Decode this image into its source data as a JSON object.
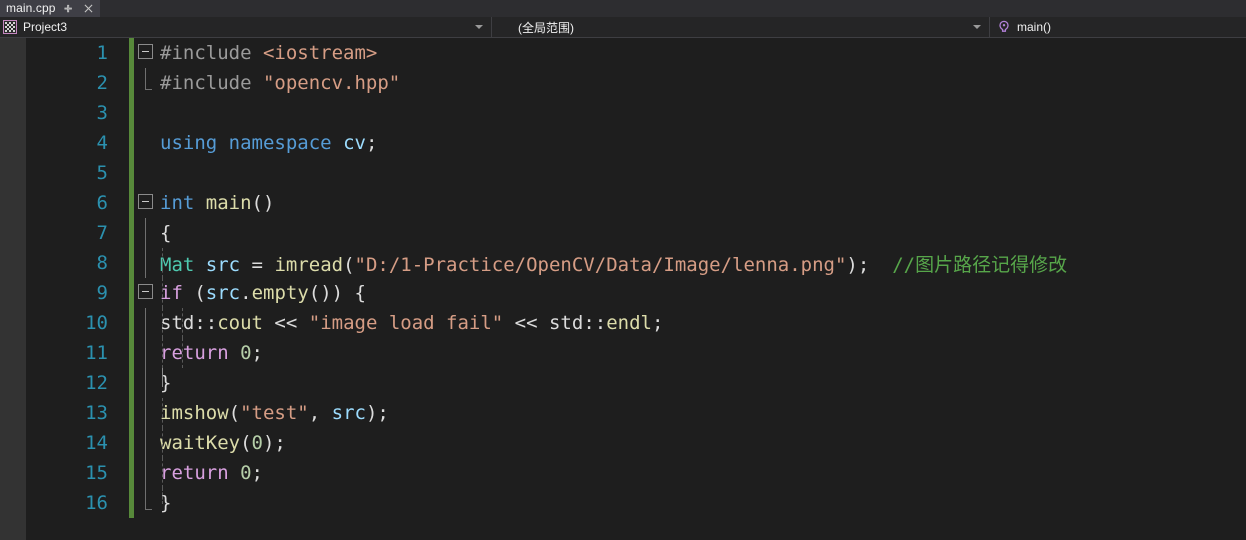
{
  "tab": {
    "label": "main.cpp",
    "pin_icon": "pin-icon",
    "close_icon": "close-icon"
  },
  "navbar": {
    "project": {
      "label": "Project3",
      "icon": "project-icon"
    },
    "scope": {
      "label": "(全局范围)"
    },
    "member": {
      "label": "main()",
      "icon": "method-icon"
    }
  },
  "editor": {
    "line_numbers": [
      "1",
      "2",
      "3",
      "4",
      "5",
      "6",
      "7",
      "8",
      "9",
      "10",
      "11",
      "12",
      "13",
      "14",
      "15",
      "16"
    ],
    "lines": [
      {
        "n": "1",
        "changed": true,
        "text": "#include <iostream>"
      },
      {
        "n": "2",
        "changed": true,
        "text": " #include \"opencv.hpp\""
      },
      {
        "n": "3",
        "changed": true,
        "text": ""
      },
      {
        "n": "4",
        "changed": true,
        "text": "  using namespace cv;"
      },
      {
        "n": "5",
        "changed": true,
        "text": ""
      },
      {
        "n": "6",
        "changed": true,
        "text": "int main()"
      },
      {
        "n": "7",
        "changed": true,
        "text": " {"
      },
      {
        "n": "8",
        "changed": true,
        "text": "    Mat src = imread(\"D:/1-Practice/OpenCV/Data/Image/lenna.png\"); //图片路径记得修改"
      },
      {
        "n": "9",
        "changed": true,
        "text": "    if (src.empty()) {"
      },
      {
        "n": "10",
        "changed": true,
        "text": "        std::cout << \"image load fail\" << std::endl;"
      },
      {
        "n": "11",
        "changed": true,
        "text": "        return 0;"
      },
      {
        "n": "12",
        "changed": true,
        "text": "    }"
      },
      {
        "n": "13",
        "changed": true,
        "text": "    imshow(\"test\", src);"
      },
      {
        "n": "14",
        "changed": true,
        "text": "    waitKey(0);"
      },
      {
        "n": "15",
        "changed": true,
        "text": "    return 0;"
      },
      {
        "n": "16",
        "changed": true,
        "text": " }"
      }
    ],
    "tokens": {
      "l1": [
        [
          "#include ",
          "t-pp"
        ],
        [
          "<iostream>",
          "t-str"
        ]
      ],
      "l2": [
        [
          "#include ",
          "t-pp"
        ],
        [
          "\"opencv.hpp\"",
          "t-str"
        ]
      ],
      "l4": [
        [
          "using",
          "t-kw"
        ],
        [
          " ",
          "t-plain"
        ],
        [
          "namespace",
          "t-kw"
        ],
        [
          " ",
          "t-plain"
        ],
        [
          "cv",
          "t-var"
        ],
        [
          ";",
          "t-punct"
        ]
      ],
      "l6": [
        [
          "int",
          "t-kw"
        ],
        [
          " ",
          "t-plain"
        ],
        [
          "main",
          "t-fn"
        ],
        [
          "()",
          "t-punct"
        ]
      ],
      "l7": [
        [
          "{",
          "t-punct"
        ]
      ],
      "l8": [
        [
          "Mat",
          "t-type"
        ],
        [
          " ",
          "t-plain"
        ],
        [
          "src",
          "t-var"
        ],
        [
          " = ",
          "t-punct"
        ],
        [
          "imread",
          "t-fn"
        ],
        [
          "(",
          "t-punct"
        ],
        [
          "\"D:/1-Practice/OpenCV/Data/Image/lenna.png\"",
          "t-str"
        ],
        [
          ");",
          "t-punct"
        ],
        [
          "  ",
          "t-plain"
        ],
        [
          "//图片路径记得修改",
          "t-cmt"
        ]
      ],
      "l9": [
        [
          "if",
          "t-ctl"
        ],
        [
          " (",
          "t-punct"
        ],
        [
          "src",
          "t-var"
        ],
        [
          ".",
          "t-punct"
        ],
        [
          "empty",
          "t-fn"
        ],
        [
          "()) {",
          "t-punct"
        ]
      ],
      "l10": [
        [
          "std",
          "t-ns"
        ],
        [
          "::",
          "t-punct"
        ],
        [
          "cout",
          "t-fn"
        ],
        [
          " << ",
          "t-punct"
        ],
        [
          "\"image load fail\"",
          "t-str"
        ],
        [
          " << ",
          "t-punct"
        ],
        [
          "std",
          "t-ns"
        ],
        [
          "::",
          "t-punct"
        ],
        [
          "endl",
          "t-fn"
        ],
        [
          ";",
          "t-punct"
        ]
      ],
      "l11": [
        [
          "return",
          "t-ctl"
        ],
        [
          " ",
          "t-plain"
        ],
        [
          "0",
          "t-num"
        ],
        [
          ";",
          "t-punct"
        ]
      ],
      "l12": [
        [
          "}",
          "t-punct"
        ]
      ],
      "l13": [
        [
          "imshow",
          "t-fn"
        ],
        [
          "(",
          "t-punct"
        ],
        [
          "\"test\"",
          "t-str"
        ],
        [
          ", ",
          "t-punct"
        ],
        [
          "src",
          "t-var"
        ],
        [
          ");",
          "t-punct"
        ]
      ],
      "l14": [
        [
          "waitKey",
          "t-fn"
        ],
        [
          "(",
          "t-punct"
        ],
        [
          "0",
          "t-num"
        ],
        [
          ");",
          "t-punct"
        ]
      ],
      "l15": [
        [
          "return",
          "t-ctl"
        ],
        [
          " ",
          "t-plain"
        ],
        [
          "0",
          "t-num"
        ],
        [
          ";",
          "t-punct"
        ]
      ],
      "l16": [
        [
          "}",
          "t-punct"
        ]
      ]
    }
  },
  "colors": {
    "editor_bg": "#1e1e1e",
    "tab_active_bg": "#3f3f46",
    "tabstrip_bg": "#2d2d30",
    "navbar_bg": "#252526",
    "linenumber": "#2b91af",
    "changebar_green": "#57893a",
    "comment_green": "#57a64a",
    "string_orange": "#d69d85",
    "keyword_blue": "#569cd6",
    "control_pink": "#d8a0df",
    "type_teal": "#4ec9b0",
    "function_yellow": "#dcdcaa",
    "variable_lightblue": "#9cdcfe",
    "number_green": "#b5cea8",
    "indicator_margin": "#333333"
  }
}
